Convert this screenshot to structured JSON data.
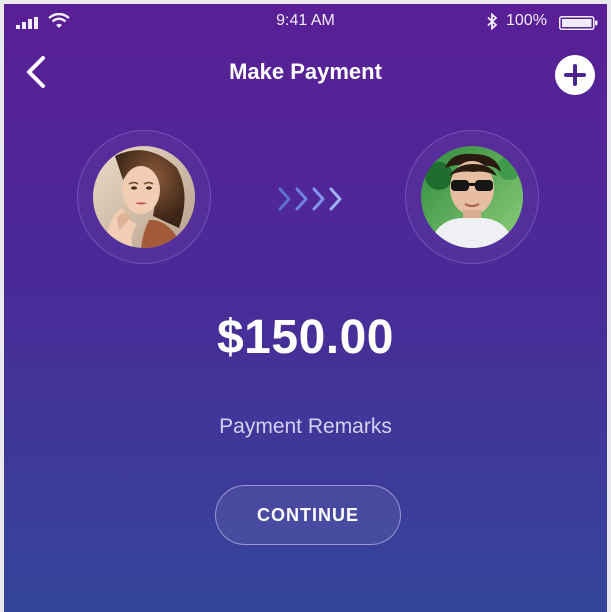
{
  "status_bar": {
    "time": "9:41 AM",
    "battery_percent": "100%",
    "icons": [
      "signal-icon",
      "wifi-icon",
      "bluetooth-icon",
      "battery-icon"
    ]
  },
  "nav": {
    "title": "Make Payment",
    "back_icon": "chevron-left-icon",
    "add_icon": "plus-icon"
  },
  "transfer": {
    "sender_avatar": "sender-avatar",
    "receiver_avatar": "receiver-avatar",
    "direction_icon": "chevrons-right-icon"
  },
  "payment": {
    "amount": "$150.00",
    "remarks_label": "Payment Remarks",
    "continue_label": "CONTINUE"
  },
  "colors": {
    "gradient_top": "#5a1f96",
    "gradient_bottom": "#34469a",
    "text": "#ffffff"
  }
}
